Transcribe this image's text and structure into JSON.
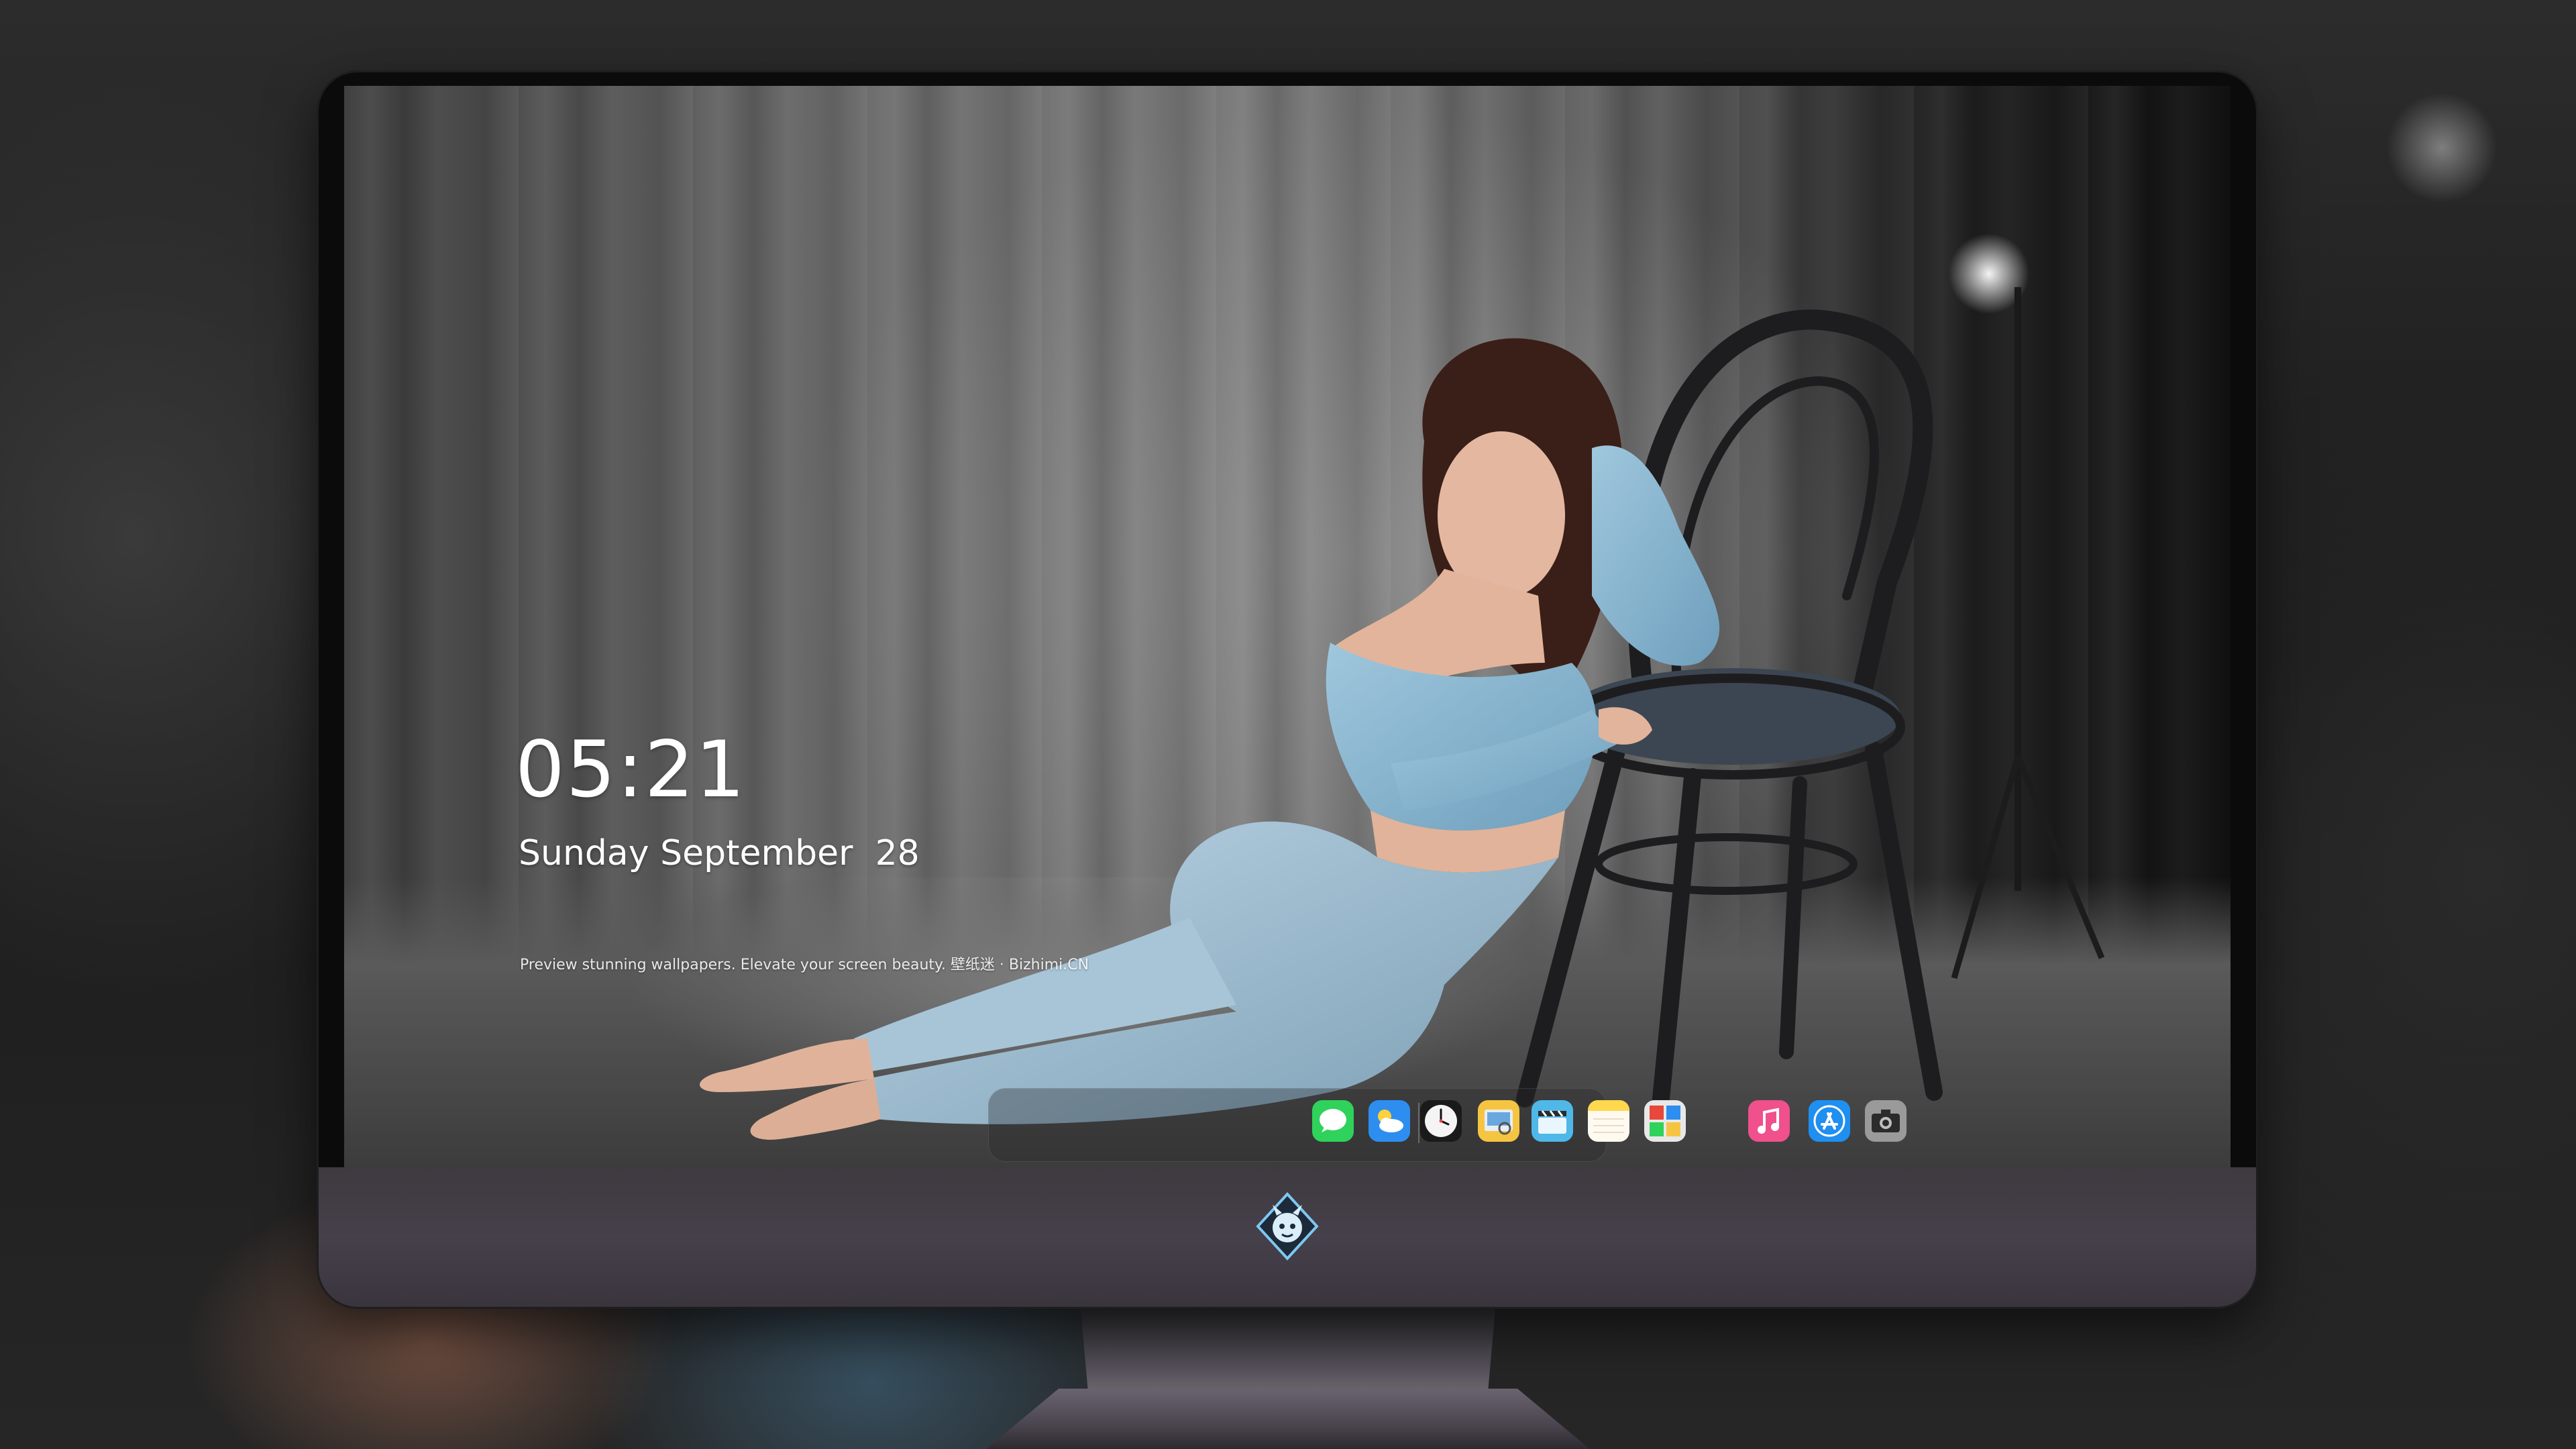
{
  "lock_screen": {
    "time": "05:21",
    "date": "Sunday September  28",
    "tagline": "Preview stunning wallpapers. Elevate your screen beauty. 壁纸迷 · Bizhimi.CN"
  },
  "dock": {
    "apps": [
      {
        "name": "Messages",
        "icon": "messages-icon",
        "color": "#2fd25a"
      },
      {
        "name": "Weather",
        "icon": "weather-icon",
        "color": "#2d8ef0"
      },
      {
        "name": "Clock",
        "icon": "clock-icon",
        "color": "#f2f2f2"
      },
      {
        "name": "Preview",
        "icon": "preview-icon",
        "color": "#f5c542"
      },
      {
        "name": "Clips",
        "icon": "clapperboard-icon",
        "color": "#4fb8e8"
      },
      {
        "name": "Notes",
        "icon": "notes-icon",
        "color": "#ffd84d"
      },
      {
        "name": "Photo Booth",
        "icon": "photo-booth-icon",
        "color": "#e8473b"
      },
      {
        "name": "Music",
        "icon": "music-icon",
        "color": "#f0508c"
      },
      {
        "name": "App Store",
        "icon": "app-store-icon",
        "color": "#1f8ff0"
      },
      {
        "name": "Camera",
        "icon": "camera-icon",
        "color": "#9a9a9a"
      }
    ]
  },
  "monitor": {
    "logo": "dragon-logo-icon"
  }
}
